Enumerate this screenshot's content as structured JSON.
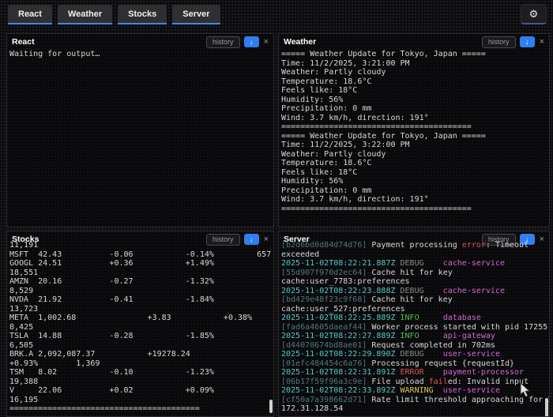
{
  "topbar": {
    "tabs": [
      {
        "label": "React"
      },
      {
        "label": "Weather"
      },
      {
        "label": "Stocks"
      },
      {
        "label": "Server"
      }
    ],
    "gear_icon": "⚙"
  },
  "icons": {
    "collapse_arrow": "↓",
    "close": "×"
  },
  "colors": {
    "tab_accent": "#4286f5",
    "collapse_button": "#2f7ff0",
    "timestamp": "#56c8c8",
    "level_debug": "#8a8a8a",
    "level_info": "#4fc14f",
    "level_error": "#e05555",
    "level_warning": "#d9c94f",
    "service_name": "#d36ad3",
    "hex_id": "#4f7a7a",
    "terminal_text": "#d8d8d8"
  },
  "panels": {
    "react": {
      "title": "React",
      "history": "history",
      "body": "Waiting for output…"
    },
    "weather": {
      "title": "Weather",
      "history": "history",
      "lines": [
        "===== Weather Update for Tokyo, Japan =====",
        "Time: 11/2/2025, 3:21:00 PM",
        "Weather: Partly cloudy",
        "Temperature: 18.6°C",
        "Feels like: 18°C",
        "Humidity: 56%",
        "Precipitation: 0 mm",
        "Wind: 3.7 km/h, direction: 191°",
        "========================================",
        "===== Weather Update for Tokyo, Japan =====",
        "Time: 11/2/2025, 3:22:00 PM",
        "Weather: Partly cloudy",
        "Temperature: 18.6°C",
        "Feels like: 18°C",
        "Humidity: 56%",
        "Precipitation: 0 mm",
        "Wind: 3.7 km/h, direction: 191°",
        "========================================"
      ]
    },
    "stocks": {
      "title": "Stocks",
      "history": "history",
      "lines": [
        "11,191",
        "MSFT  42.43          -0.06           -0.14%         657",
        "GOOGL 24.51          +0.36           +1.49%",
        "18,551",
        "AMZN  20.16          -0.27           -1.32%",
        "8,529",
        "NVDA  21.92          -0.41           -1.84%",
        "13,723",
        "META  1,002.68               +3.83           +0.38%",
        "8,425",
        "TSLA  14.88          -0.28           -1.85%",
        "6,505",
        "BRK.A 2,092,087.37           +19278.24",
        "+0.93%        1,369",
        "TSM   8.02           -0.10           -1.23%",
        "19,388",
        "V     22.06          +0.02           +0.09%",
        "16,195",
        "========================================"
      ]
    },
    "server": {
      "title": "Server",
      "history": "history",
      "log": [
        [
          {
            "t": "[b2d6bd0d84d74d76]",
            "c": "id"
          },
          {
            "t": " Payment processing ",
            "c": "msg"
          },
          {
            "t": "error",
            "c": "err"
          },
          {
            "t": ": Timeout",
            "c": "msg"
          }
        ],
        [
          {
            "t": "exceeded",
            "c": "msg"
          }
        ],
        [
          {
            "t": "2025-11-02T08:22:21.887Z ",
            "c": "ts"
          },
          {
            "t": "DEBUG",
            "c": "debug"
          },
          {
            "t": "    ",
            "c": "msg"
          },
          {
            "t": "cache-service",
            "c": "svc"
          }
        ],
        [
          {
            "t": "[55d907f970d2ec64]",
            "c": "id"
          },
          {
            "t": " Cache hit for key",
            "c": "msg"
          }
        ],
        [
          {
            "t": "cache:user_7783:preferences",
            "c": "msg"
          }
        ],
        [
          {
            "t": "2025-11-02T08:22:23.888Z ",
            "c": "ts"
          },
          {
            "t": "DEBUG",
            "c": "debug"
          },
          {
            "t": "    ",
            "c": "msg"
          },
          {
            "t": "cache-service",
            "c": "svc"
          }
        ],
        [
          {
            "t": "[bd429e48f23c9f68]",
            "c": "id"
          },
          {
            "t": " Cache hit for key",
            "c": "msg"
          }
        ],
        [
          {
            "t": "cache:user_527:preferences",
            "c": "msg"
          }
        ],
        [
          {
            "t": "2025-11-02T08:22:25.889Z ",
            "c": "ts"
          },
          {
            "t": "INFO",
            "c": "info"
          },
          {
            "t": "     ",
            "c": "msg"
          },
          {
            "t": "database",
            "c": "svc"
          }
        ],
        [
          {
            "t": "[fad6a4605daeaf44]",
            "c": "id"
          },
          {
            "t": " Worker process started with pid 17255",
            "c": "msg"
          }
        ],
        [
          {
            "t": "2025-11-02T08:22:27.889Z ",
            "c": "ts"
          },
          {
            "t": "INFO",
            "c": "info"
          },
          {
            "t": "     ",
            "c": "msg"
          },
          {
            "t": "api-gateway",
            "c": "svc"
          }
        ],
        [
          {
            "t": "[d44070674bd8ae01]",
            "c": "id"
          },
          {
            "t": " Request completed in 702ms",
            "c": "msg"
          }
        ],
        [
          {
            "t": "2025-11-02T08:22:29.890Z ",
            "c": "ts"
          },
          {
            "t": "DEBUG",
            "c": "debug"
          },
          {
            "t": "    ",
            "c": "msg"
          },
          {
            "t": "user-service",
            "c": "svc"
          }
        ],
        [
          {
            "t": "[01efc484454c6a76]",
            "c": "id"
          },
          {
            "t": " Processing request {requestId}",
            "c": "msg"
          }
        ],
        [
          {
            "t": "2025-11-02T08:22:31.891Z ",
            "c": "ts"
          },
          {
            "t": "ERROR",
            "c": "err"
          },
          {
            "t": "    ",
            "c": "msg"
          },
          {
            "t": "payment-processor",
            "c": "svc"
          }
        ],
        [
          {
            "t": "[06b17f59f96a3c9e]",
            "c": "id"
          },
          {
            "t": " File upload ",
            "c": "msg"
          },
          {
            "t": "fail",
            "c": "err"
          },
          {
            "t": "ed: Invalid input",
            "c": "msg"
          }
        ],
        [
          {
            "t": "2025-11-02T08:22:33.892Z ",
            "c": "ts"
          },
          {
            "t": "WARNING",
            "c": "warn"
          },
          {
            "t": "  ",
            "c": "msg"
          },
          {
            "t": "user-service",
            "c": "svc"
          }
        ],
        [
          {
            "t": "[cf50a7a398662d71]",
            "c": "id"
          },
          {
            "t": " Rate limit threshold approaching for IP",
            "c": "msg"
          }
        ],
        [
          {
            "t": "172.31.128.54",
            "c": "msg"
          }
        ]
      ]
    }
  }
}
